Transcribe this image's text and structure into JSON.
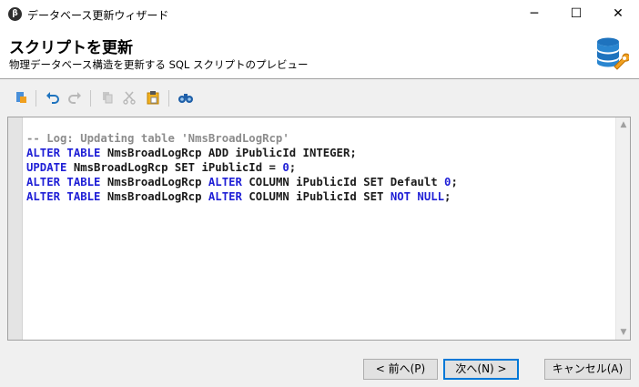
{
  "window": {
    "title": "データベース更新ウィザード",
    "app_icon_glyph": "β",
    "minimize_glyph": "─",
    "maximize_glyph": "☐",
    "close_glyph": "✕"
  },
  "header": {
    "title": "スクリプトを更新",
    "subtitle": "物理データベース構造を更新する SQL スクリプトのプレビュー",
    "icon": "database-wrench-icon"
  },
  "toolbar": {
    "buttons": [
      {
        "icon": "import-icon",
        "enabled": true
      },
      {
        "icon": "undo-icon",
        "enabled": true
      },
      {
        "icon": "redo-icon",
        "enabled": false
      },
      {
        "icon": "copy-icon",
        "enabled": false
      },
      {
        "icon": "cut-icon",
        "enabled": false
      },
      {
        "icon": "paste-icon",
        "enabled": true
      },
      {
        "icon": "find-binoculars-icon",
        "enabled": true
      }
    ]
  },
  "editor": {
    "lines": [
      [
        {
          "t": "cm",
          "v": "-- Log: Updating table 'NmsBroadLogRcp'"
        }
      ],
      [
        {
          "t": "kw",
          "v": "ALTER TABLE"
        },
        {
          "t": "tx",
          "v": " NmsBroadLogRcp ADD iPublicId INTEGER;"
        }
      ],
      [
        {
          "t": "kw",
          "v": "UPDATE"
        },
        {
          "t": "tx",
          "v": " NmsBroadLogRcp SET iPublicId = "
        },
        {
          "t": "kw",
          "v": "0"
        },
        {
          "t": "tx",
          "v": ";"
        }
      ],
      [
        {
          "t": "kw",
          "v": "ALTER TABLE"
        },
        {
          "t": "tx",
          "v": " NmsBroadLogRcp "
        },
        {
          "t": "kw",
          "v": "ALTER"
        },
        {
          "t": "tx",
          "v": " COLUMN iPublicId SET Default "
        },
        {
          "t": "kw",
          "v": "0"
        },
        {
          "t": "tx",
          "v": ";"
        }
      ],
      [
        {
          "t": "kw",
          "v": "ALTER TABLE"
        },
        {
          "t": "tx",
          "v": " NmsBroadLogRcp "
        },
        {
          "t": "kw",
          "v": "ALTER"
        },
        {
          "t": "tx",
          "v": " COLUMN iPublicId SET "
        },
        {
          "t": "kw",
          "v": "NOT NULL"
        },
        {
          "t": "tx",
          "v": ";"
        }
      ]
    ],
    "colors": {
      "comment": "#8c8c8c",
      "keyword": "#1f1fd6",
      "text": "#1a1a1a"
    }
  },
  "footer": {
    "prev_label": "< 前へ(P)",
    "next_label": "次へ(N) >",
    "cancel_label": "キャンセル(A)"
  }
}
